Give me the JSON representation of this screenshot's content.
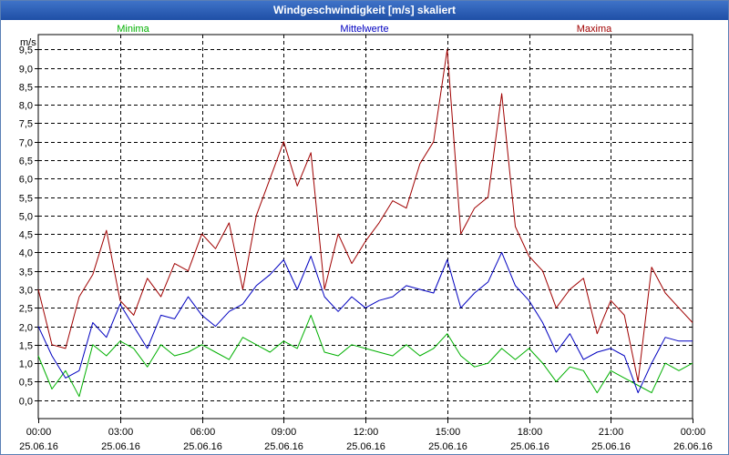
{
  "chart_data": {
    "type": "line",
    "title": "Windgeschwindigkeit [m/s] skaliert",
    "ylabel": "m/s",
    "ylim": [
      -0.5,
      9.9
    ],
    "yticks": [
      "0,0",
      "0,5",
      "1,0",
      "1,5",
      "2,0",
      "2,5",
      "3,0",
      "3,5",
      "4,0",
      "4,5",
      "5,0",
      "5,5",
      "6,0",
      "6,5",
      "7,0",
      "7,5",
      "8,0",
      "8,5",
      "9,0",
      "9,5"
    ],
    "xlim": [
      0,
      24
    ],
    "xticks": [
      {
        "time": "00:00",
        "date": "25.06.16"
      },
      {
        "time": "03:00",
        "date": "25.06.16"
      },
      {
        "time": "06:00",
        "date": "25.06.16"
      },
      {
        "time": "09:00",
        "date": "25.06.16"
      },
      {
        "time": "12:00",
        "date": "25.06.16"
      },
      {
        "time": "15:00",
        "date": "25.06.16"
      },
      {
        "time": "18:00",
        "date": "25.06.16"
      },
      {
        "time": "21:00",
        "date": "25.06.16"
      },
      {
        "time": "00:00",
        "date": "26.06.16"
      }
    ],
    "grid": true,
    "legend_placement": "top",
    "series": [
      {
        "name": "Minima",
        "color": "#00b000",
        "x": [
          0,
          0.5,
          1,
          1.5,
          2,
          2.5,
          3,
          3.5,
          4,
          4.5,
          5,
          5.5,
          6,
          6.5,
          7,
          7.5,
          8,
          8.5,
          9,
          9.5,
          10,
          10.5,
          11,
          11.5,
          12,
          12.5,
          13,
          13.5,
          14,
          14.5,
          15,
          15.5,
          16,
          16.5,
          17,
          17.5,
          18,
          18.5,
          19,
          19.5,
          20,
          20.5,
          21,
          21.5,
          22,
          22.5,
          23,
          23.5,
          24
        ],
        "values": [
          1.2,
          0.3,
          0.8,
          0.1,
          1.5,
          1.2,
          1.6,
          1.4,
          0.9,
          1.5,
          1.2,
          1.3,
          1.5,
          1.3,
          1.1,
          1.7,
          1.5,
          1.3,
          1.6,
          1.4,
          2.3,
          1.3,
          1.2,
          1.5,
          1.4,
          1.3,
          1.2,
          1.5,
          1.2,
          1.4,
          1.8,
          1.2,
          0.9,
          1.0,
          1.4,
          1.1,
          1.4,
          1.0,
          0.5,
          0.9,
          0.8,
          0.2,
          0.8,
          0.6,
          0.4,
          0.2,
          1.0,
          0.8,
          1.0
        ]
      },
      {
        "name": "Mittelwerte",
        "color": "#0000c0",
        "x": [
          0,
          0.5,
          1,
          1.5,
          2,
          2.5,
          3,
          3.5,
          4,
          4.5,
          5,
          5.5,
          6,
          6.5,
          7,
          7.5,
          8,
          8.5,
          9,
          9.5,
          10,
          10.5,
          11,
          11.5,
          12,
          12.5,
          13,
          13.5,
          14,
          14.5,
          15,
          15.5,
          16,
          16.5,
          17,
          17.5,
          18,
          18.5,
          19,
          19.5,
          20,
          20.5,
          21,
          21.5,
          22,
          22.5,
          23,
          23.5,
          24
        ],
        "values": [
          2.0,
          1.2,
          0.6,
          0.8,
          2.1,
          1.7,
          2.6,
          2.0,
          1.4,
          2.3,
          2.2,
          2.8,
          2.3,
          2.0,
          2.4,
          2.6,
          3.1,
          3.4,
          3.8,
          3.0,
          3.9,
          2.8,
          2.4,
          2.8,
          2.5,
          2.7,
          2.8,
          3.1,
          3.0,
          2.9,
          3.8,
          2.5,
          2.9,
          3.2,
          4.0,
          3.1,
          2.7,
          2.1,
          1.3,
          1.8,
          1.1,
          1.3,
          1.4,
          1.2,
          0.2,
          1.0,
          1.7,
          1.6,
          1.6
        ]
      },
      {
        "name": "Maxima",
        "color": "#a00000",
        "x": [
          0,
          0.5,
          1,
          1.5,
          2,
          2.5,
          3,
          3.5,
          4,
          4.5,
          5,
          5.5,
          6,
          6.5,
          7,
          7.5,
          8,
          8.5,
          9,
          9.5,
          10,
          10.5,
          11,
          11.5,
          12,
          12.5,
          13,
          13.5,
          14,
          14.5,
          15,
          15.5,
          16,
          16.5,
          17,
          17.5,
          18,
          18.5,
          19,
          19.5,
          20,
          20.5,
          21,
          21.5,
          22,
          22.5,
          23,
          23.5,
          24
        ],
        "values": [
          3.0,
          1.5,
          1.4,
          2.8,
          3.4,
          4.6,
          2.7,
          2.3,
          3.3,
          2.8,
          3.7,
          3.5,
          4.5,
          4.1,
          4.8,
          3.0,
          5.0,
          6.0,
          7.0,
          5.8,
          6.7,
          3.0,
          4.5,
          3.7,
          4.3,
          4.8,
          5.4,
          5.2,
          6.4,
          7.0,
          9.5,
          4.5,
          5.2,
          5.5,
          8.3,
          4.7,
          3.9,
          3.5,
          2.5,
          3.0,
          3.3,
          1.8,
          2.7,
          2.3,
          0.5,
          3.6,
          2.9,
          2.5,
          2.1
        ]
      }
    ]
  }
}
